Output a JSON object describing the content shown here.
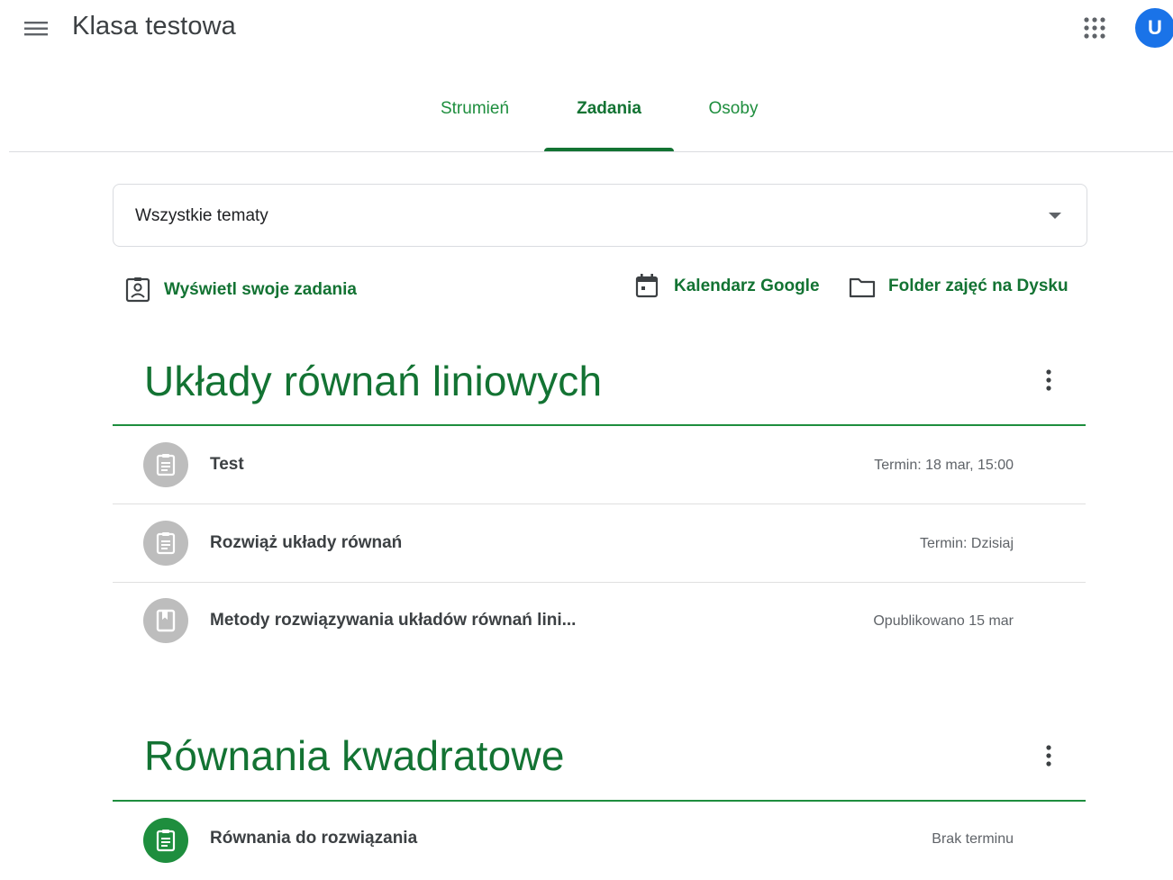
{
  "header": {
    "title": "Klasa testowa",
    "menu_icon": "hamburger-menu-icon",
    "apps_icon": "google-apps-grid-icon",
    "avatar_initial": "U",
    "avatar_color": "#1a73e8"
  },
  "tabs": [
    {
      "label": "Strumień",
      "active": false
    },
    {
      "label": "Zadania",
      "active": true
    },
    {
      "label": "Osoby",
      "active": false
    }
  ],
  "filter": {
    "selected_topic": "Wszystkie tematy"
  },
  "actions": {
    "view_work": "Wyświetl swoje zadania",
    "calendar": "Kalendarz Google",
    "drive_folder": "Folder zajęć na Dysku"
  },
  "sections": [
    {
      "title": "Układy równań liniowych",
      "items": [
        {
          "title": "Test",
          "meta": "Termin: 18 mar, 15:00",
          "type": "assignment",
          "icon": "assignment-icon"
        },
        {
          "title": "Rozwiąż układy równań",
          "meta": "Termin: Dzisiaj",
          "type": "assignment",
          "icon": "assignment-icon"
        },
        {
          "title": "Metody rozwiązywania układów równań lini...",
          "meta": "Opublikowano 15 mar",
          "type": "material",
          "icon": "material-bookmark-icon"
        }
      ]
    },
    {
      "title": "Równania kwadratowe",
      "items": [
        {
          "title": "Równania do rozwiązania",
          "meta": "Brak terminu",
          "type": "assignment",
          "icon": "assignment-icon"
        }
      ]
    }
  ],
  "colors": {
    "accent_green": "#137333",
    "link_green": "#1e8e3e",
    "inactive_icon_gray": "#bdbdbd"
  }
}
